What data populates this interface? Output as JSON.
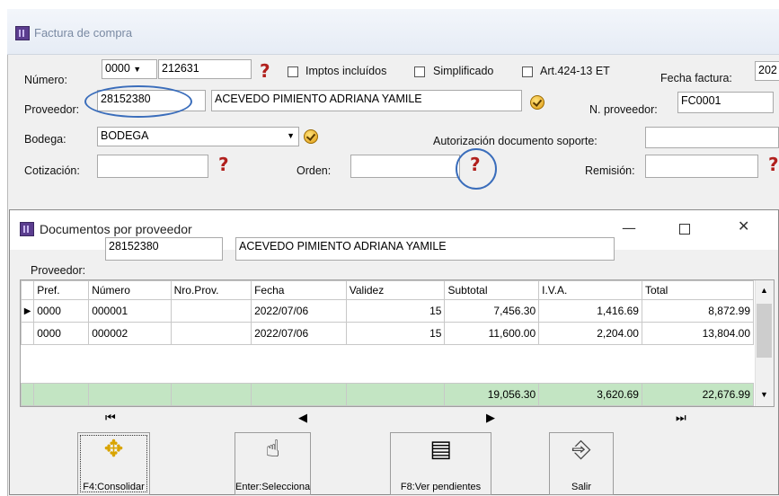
{
  "main": {
    "title": "Factura de compra",
    "numero_label": "Número:",
    "numero_prefix": "0000",
    "numero_value": "212631",
    "imptos_label": "Imptos incluídos",
    "simplificado_label": "Simplificado",
    "art_label": "Art.424-13 ET",
    "fecha_label": "Fecha factura:",
    "fecha_value": "202",
    "proveedor_label": "Proveedor:",
    "proveedor_code": "28152380",
    "proveedor_name": "ACEVEDO PIMIENTO ADRIANA YAMILE",
    "nproveedor_label": "N. proveedor:",
    "nproveedor_value": "FC0001",
    "bodega_label": "Bodega:",
    "bodega_value": "BODEGA",
    "autorizacion_label": "Autorización documento soporte:",
    "autorizacion_value": "",
    "cotizacion_label": "Cotización:",
    "cotizacion_value": "",
    "orden_label": "Orden:",
    "orden_value": "",
    "remision_label": "Remisión:",
    "remision_value": ""
  },
  "dialog": {
    "title": "Documentos por proveedor",
    "proveedor_label": "Proveedor:",
    "proveedor_code": "28152380",
    "proveedor_name": "ACEVEDO PIMIENTO ADRIANA YAMILE",
    "columns": [
      "Pref.",
      "Número",
      "Nro.Prov.",
      "Fecha",
      "Validez",
      "Subtotal",
      "I.V.A.",
      "Total"
    ],
    "rows": [
      {
        "pref": "0000",
        "numero": "000001",
        "nroprov": "",
        "fecha": "2022/07/06",
        "validez": "15",
        "subtotal": "7,456.30",
        "iva": "1,416.69",
        "total": "8,872.99"
      },
      {
        "pref": "0000",
        "numero": "000002",
        "nroprov": "",
        "fecha": "2022/07/06",
        "validez": "15",
        "subtotal": "11,600.00",
        "iva": "2,204.00",
        "total": "13,804.00"
      }
    ],
    "totals": {
      "subtotal": "19,056.30",
      "iva": "3,620.69",
      "total": "22,676.99"
    },
    "buttons": {
      "consolidar": "F4:Consolidar",
      "selecciona": "Enter:Selecciona",
      "pendientes": "F8:Ver pendientes",
      "salir": "Salir"
    }
  },
  "icons": {
    "help": "question-mark-icon",
    "check": "check-circle-icon",
    "consolidate": "consolidate-arrows-icon",
    "hand": "hand-pointer-icon",
    "document": "document-list-icon",
    "exit": "exit-door-icon"
  },
  "colors": {
    "totals_row": "#c3e5c3",
    "help_mark": "#b1201d",
    "annotation_circle": "#3a6dbb"
  }
}
